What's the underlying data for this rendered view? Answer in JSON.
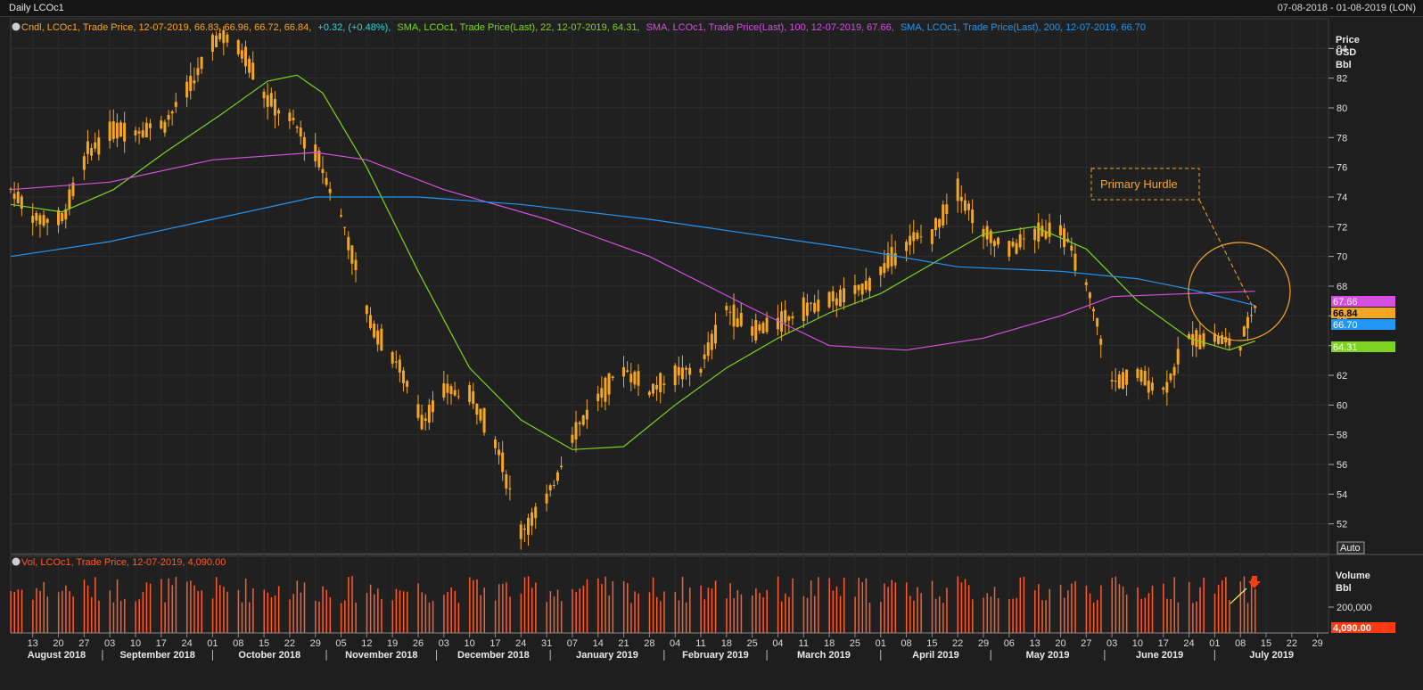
{
  "window": {
    "title": "Daily LCOc1",
    "date_range": "07-08-2018 - 01-08-2019 (LON)"
  },
  "legend": {
    "candle": {
      "prefix": "Cndl, LCOc1, Trade Price,  12-07-2019, 66.83, 66.96, 66.72, 66.84,",
      "change": "+0.32, (+0.48%),",
      "color": "#f5a623",
      "change_color": "#28d8d8"
    },
    "sma22": {
      "text": "SMA, LCOc1, Trade Price(Last),   22,  12-07-2019, 64.31,",
      "color": "#7ed321"
    },
    "sma100": {
      "text": "SMA, LCOc1, Trade Price(Last),   100,  12-07-2019, 67.66,",
      "color": "#d64fe0"
    },
    "sma200": {
      "text": "SMA, LCOc1, Trade Price(Last),   200,  12-07-2019, 66.70",
      "color": "#2196f3"
    },
    "volume": {
      "text": "Vol, LCOc1, Trade Price,  12-07-2019, 4,090.00",
      "color": "#ff5b2e"
    }
  },
  "price_axis": {
    "label_line1": "Price",
    "label_line2": "USD",
    "label_line3": "Bbl",
    "ticks": [
      "84",
      "82",
      "80",
      "78",
      "76",
      "74",
      "72",
      "70",
      "68",
      "66",
      "64",
      "62",
      "60",
      "58",
      "56",
      "54",
      "52"
    ],
    "auto_label": "Auto"
  },
  "volume_axis": {
    "label_line1": "Volume",
    "label_line2": "Bbl",
    "tick": "200,000"
  },
  "value_tags": {
    "sma100": {
      "text": "67.66",
      "color": "#d64fe0"
    },
    "last": {
      "text": "66.84",
      "color": "#f5a623"
    },
    "sma200": {
      "text": "66.70",
      "color": "#2196f3"
    },
    "sma22": {
      "text": "64.31",
      "color": "#7ed321"
    },
    "volume": {
      "text": "4,090.00",
      "color": "#ff3a10"
    }
  },
  "annotation": {
    "label": "Primary Hurdle",
    "color": "#f5a623"
  },
  "x_axis": {
    "day_ticks": [
      "13",
      "20",
      "27",
      "03",
      "10",
      "17",
      "24",
      "01",
      "08",
      "15",
      "22",
      "29",
      "05",
      "12",
      "19",
      "26",
      "03",
      "10",
      "17",
      "24",
      "31",
      "07",
      "14",
      "21",
      "28",
      "04",
      "11",
      "18",
      "25",
      "04",
      "11",
      "18",
      "25",
      "01",
      "08",
      "15",
      "22",
      "29",
      "06",
      "13",
      "20",
      "27",
      "03",
      "10",
      "17",
      "24",
      "01",
      "08",
      "15",
      "22",
      "29"
    ],
    "months": [
      "August 2018",
      "September 2018",
      "October 2018",
      "November 2018",
      "December 2018",
      "January 2019",
      "February 2019",
      "March 2019",
      "April 2019",
      "May 2019",
      "June 2019",
      "July 2019"
    ]
  },
  "chart_data": {
    "type": "candlestick",
    "instrument": "LCOc1",
    "ylim": [
      50,
      86
    ],
    "x_range": [
      "2018-08-07",
      "2019-08-01"
    ],
    "price_path": [
      [
        "2018-08-07",
        74.5
      ],
      [
        "2018-08-14",
        72.5
      ],
      [
        "2018-08-21",
        72.5
      ],
      [
        "2018-08-28",
        77.0
      ],
      [
        "2018-09-04",
        78.5
      ],
      [
        "2018-09-11",
        78.5
      ],
      [
        "2018-09-18",
        79.0
      ],
      [
        "2018-09-25",
        81.5
      ],
      [
        "2018-10-03",
        85.0
      ],
      [
        "2018-10-10",
        83.5
      ],
      [
        "2018-10-16",
        80.5
      ],
      [
        "2018-10-23",
        79.0
      ],
      [
        "2018-10-30",
        76.5
      ],
      [
        "2018-11-06",
        72.0
      ],
      [
        "2018-11-13",
        65.5
      ],
      [
        "2018-11-20",
        63.0
      ],
      [
        "2018-11-27",
        59.0
      ],
      [
        "2018-12-04",
        61.0
      ],
      [
        "2018-12-11",
        60.5
      ],
      [
        "2018-12-18",
        57.0
      ],
      [
        "2018-12-24",
        51.5
      ],
      [
        "2018-12-31",
        53.5
      ],
      [
        "2019-01-07",
        58.0
      ],
      [
        "2019-01-14",
        60.5
      ],
      [
        "2019-01-21",
        62.5
      ],
      [
        "2019-01-28",
        61.0
      ],
      [
        "2019-02-04",
        62.0
      ],
      [
        "2019-02-11",
        62.5
      ],
      [
        "2019-02-18",
        66.5
      ],
      [
        "2019-02-25",
        65.0
      ],
      [
        "2019-03-04",
        65.5
      ],
      [
        "2019-03-11",
        66.5
      ],
      [
        "2019-03-18",
        67.0
      ],
      [
        "2019-03-25",
        67.5
      ],
      [
        "2019-04-01",
        69.0
      ],
      [
        "2019-04-08",
        71.0
      ],
      [
        "2019-04-15",
        71.5
      ],
      [
        "2019-04-22",
        74.5
      ],
      [
        "2019-04-29",
        71.5
      ],
      [
        "2019-05-06",
        70.5
      ],
      [
        "2019-05-13",
        71.5
      ],
      [
        "2019-05-20",
        72.0
      ],
      [
        "2019-05-27",
        68.0
      ],
      [
        "2019-05-31",
        64.5
      ],
      [
        "2019-06-03",
        61.5
      ],
      [
        "2019-06-10",
        62.0
      ],
      [
        "2019-06-17",
        61.0
      ],
      [
        "2019-06-24",
        64.5
      ],
      [
        "2019-07-01",
        64.5
      ],
      [
        "2019-07-08",
        64.0
      ],
      [
        "2019-07-12",
        66.84
      ]
    ],
    "series": [
      {
        "name": "SMA, LCOc1, Trade Price(Last), 22",
        "color": "#7ed321",
        "points": [
          [
            "2018-08-07",
            73.5
          ],
          [
            "2018-08-21",
            73.0
          ],
          [
            "2018-09-04",
            74.5
          ],
          [
            "2018-09-18",
            77.0
          ],
          [
            "2018-10-03",
            79.5
          ],
          [
            "2018-10-16",
            81.8
          ],
          [
            "2018-10-24",
            82.2
          ],
          [
            "2018-10-31",
            81.0
          ],
          [
            "2018-11-12",
            76.0
          ],
          [
            "2018-11-26",
            69.0
          ],
          [
            "2018-12-10",
            62.5
          ],
          [
            "2018-12-24",
            59.0
          ],
          [
            "2019-01-07",
            57.0
          ],
          [
            "2019-01-21",
            57.2
          ],
          [
            "2019-02-04",
            60.0
          ],
          [
            "2019-02-18",
            62.5
          ],
          [
            "2019-03-04",
            64.5
          ],
          [
            "2019-03-18",
            66.2
          ],
          [
            "2019-04-01",
            67.5
          ],
          [
            "2019-04-15",
            69.5
          ],
          [
            "2019-04-29",
            71.5
          ],
          [
            "2019-05-13",
            72.0
          ],
          [
            "2019-05-27",
            70.5
          ],
          [
            "2019-06-10",
            67.0
          ],
          [
            "2019-06-24",
            64.5
          ],
          [
            "2019-07-05",
            63.7
          ],
          [
            "2019-07-12",
            64.31
          ]
        ]
      },
      {
        "name": "SMA, LCOc1, Trade Price(Last), 100",
        "color": "#d64fe0",
        "points": [
          [
            "2018-08-07",
            74.5
          ],
          [
            "2018-09-03",
            75.0
          ],
          [
            "2018-10-01",
            76.5
          ],
          [
            "2018-10-29",
            77.0
          ],
          [
            "2018-11-12",
            76.5
          ],
          [
            "2018-12-03",
            74.5
          ],
          [
            "2018-12-31",
            72.5
          ],
          [
            "2019-01-28",
            70.0
          ],
          [
            "2019-02-25",
            66.5
          ],
          [
            "2019-03-18",
            64.0
          ],
          [
            "2019-04-08",
            63.7
          ],
          [
            "2019-04-29",
            64.5
          ],
          [
            "2019-05-20",
            66.0
          ],
          [
            "2019-06-03",
            67.3
          ],
          [
            "2019-06-24",
            67.5
          ],
          [
            "2019-07-12",
            67.66
          ]
        ]
      },
      {
        "name": "SMA, LCOc1, Trade Price(Last), 200",
        "color": "#2196f3",
        "points": [
          [
            "2018-08-07",
            70.0
          ],
          [
            "2018-09-03",
            71.0
          ],
          [
            "2018-10-01",
            72.5
          ],
          [
            "2018-10-29",
            74.0
          ],
          [
            "2018-11-26",
            74.0
          ],
          [
            "2018-12-24",
            73.5
          ],
          [
            "2019-01-28",
            72.5
          ],
          [
            "2019-02-25",
            71.5
          ],
          [
            "2019-03-25",
            70.5
          ],
          [
            "2019-04-22",
            69.3
          ],
          [
            "2019-05-20",
            69.0
          ],
          [
            "2019-06-10",
            68.5
          ],
          [
            "2019-06-24",
            67.8
          ],
          [
            "2019-07-12",
            66.7
          ]
        ]
      }
    ],
    "last": {
      "date": "2019-07-12",
      "open": 66.83,
      "high": 66.96,
      "low": 66.72,
      "close": 66.84,
      "change": 0.32,
      "change_pct": 0.48
    },
    "volume": {
      "last": 4090,
      "typical": 200000
    }
  }
}
